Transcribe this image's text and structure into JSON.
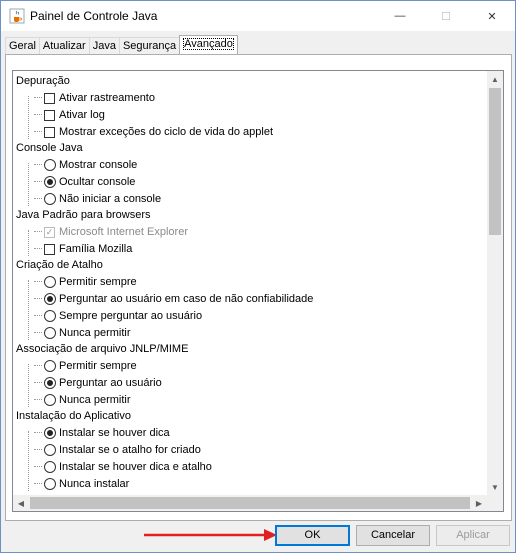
{
  "window": {
    "title": "Painel de Controle Java",
    "minimize_glyph": "—",
    "maximize_glyph": "☐",
    "close_glyph": "✕"
  },
  "tabs": [
    {
      "label": "Geral",
      "active": false
    },
    {
      "label": "Atualizar",
      "active": false
    },
    {
      "label": "Java",
      "active": false
    },
    {
      "label": "Segurança",
      "active": false
    },
    {
      "label": "Avançado",
      "active": true
    }
  ],
  "tree": {
    "categories": {
      "depuracao": "Depuração",
      "console": "Console Java",
      "browsers": "Java Padrão para browsers",
      "atalho": "Criação de Atalho",
      "jnlp": "Associação de arquivo JNLP/MIME",
      "instalacao": "Instalação do Aplicativo"
    },
    "depuracao": [
      {
        "label": "Ativar rastreamento",
        "type": "checkbox",
        "checked": false
      },
      {
        "label": "Ativar log",
        "type": "checkbox",
        "checked": false
      },
      {
        "label": "Mostrar exceções do ciclo de vida do applet",
        "type": "checkbox",
        "checked": false
      }
    ],
    "console": [
      {
        "label": "Mostrar console",
        "type": "radio",
        "checked": false
      },
      {
        "label": "Ocultar console",
        "type": "radio",
        "checked": true
      },
      {
        "label": "Não iniciar a console",
        "type": "radio",
        "checked": false
      }
    ],
    "browsers": [
      {
        "label": "Microsoft Internet Explorer",
        "type": "checkbox",
        "checked": true,
        "disabled": true
      },
      {
        "label": "Família Mozilla",
        "type": "checkbox",
        "checked": false
      }
    ],
    "atalho": [
      {
        "label": "Permitir sempre",
        "type": "radio",
        "checked": false
      },
      {
        "label": "Perguntar ao usuário em caso de não confiabilidade",
        "type": "radio",
        "checked": true
      },
      {
        "label": "Sempre perguntar ao usuário",
        "type": "radio",
        "checked": false
      },
      {
        "label": "Nunca permitir",
        "type": "radio",
        "checked": false
      }
    ],
    "jnlp": [
      {
        "label": "Permitir sempre",
        "type": "radio",
        "checked": false
      },
      {
        "label": "Perguntar ao usuário",
        "type": "radio",
        "checked": true
      },
      {
        "label": "Nunca permitir",
        "type": "radio",
        "checked": false
      }
    ],
    "instalacao": [
      {
        "label": "Instalar se houver dica",
        "type": "radio",
        "checked": true
      },
      {
        "label": "Instalar se o atalho for criado",
        "type": "radio",
        "checked": false
      },
      {
        "label": "Instalar se houver dica e atalho",
        "type": "radio",
        "checked": false
      },
      {
        "label": "Nunca instalar",
        "type": "radio",
        "checked": false
      }
    ]
  },
  "buttons": {
    "ok": "OK",
    "cancel": "Cancelar",
    "apply": "Aplicar"
  },
  "colors": {
    "annotation_arrow": "#e02020",
    "ok_focus_border": "#0078d7"
  },
  "icons": {
    "app": "java-coffee-cup-icon",
    "annotation": "red-arrow-icon"
  }
}
